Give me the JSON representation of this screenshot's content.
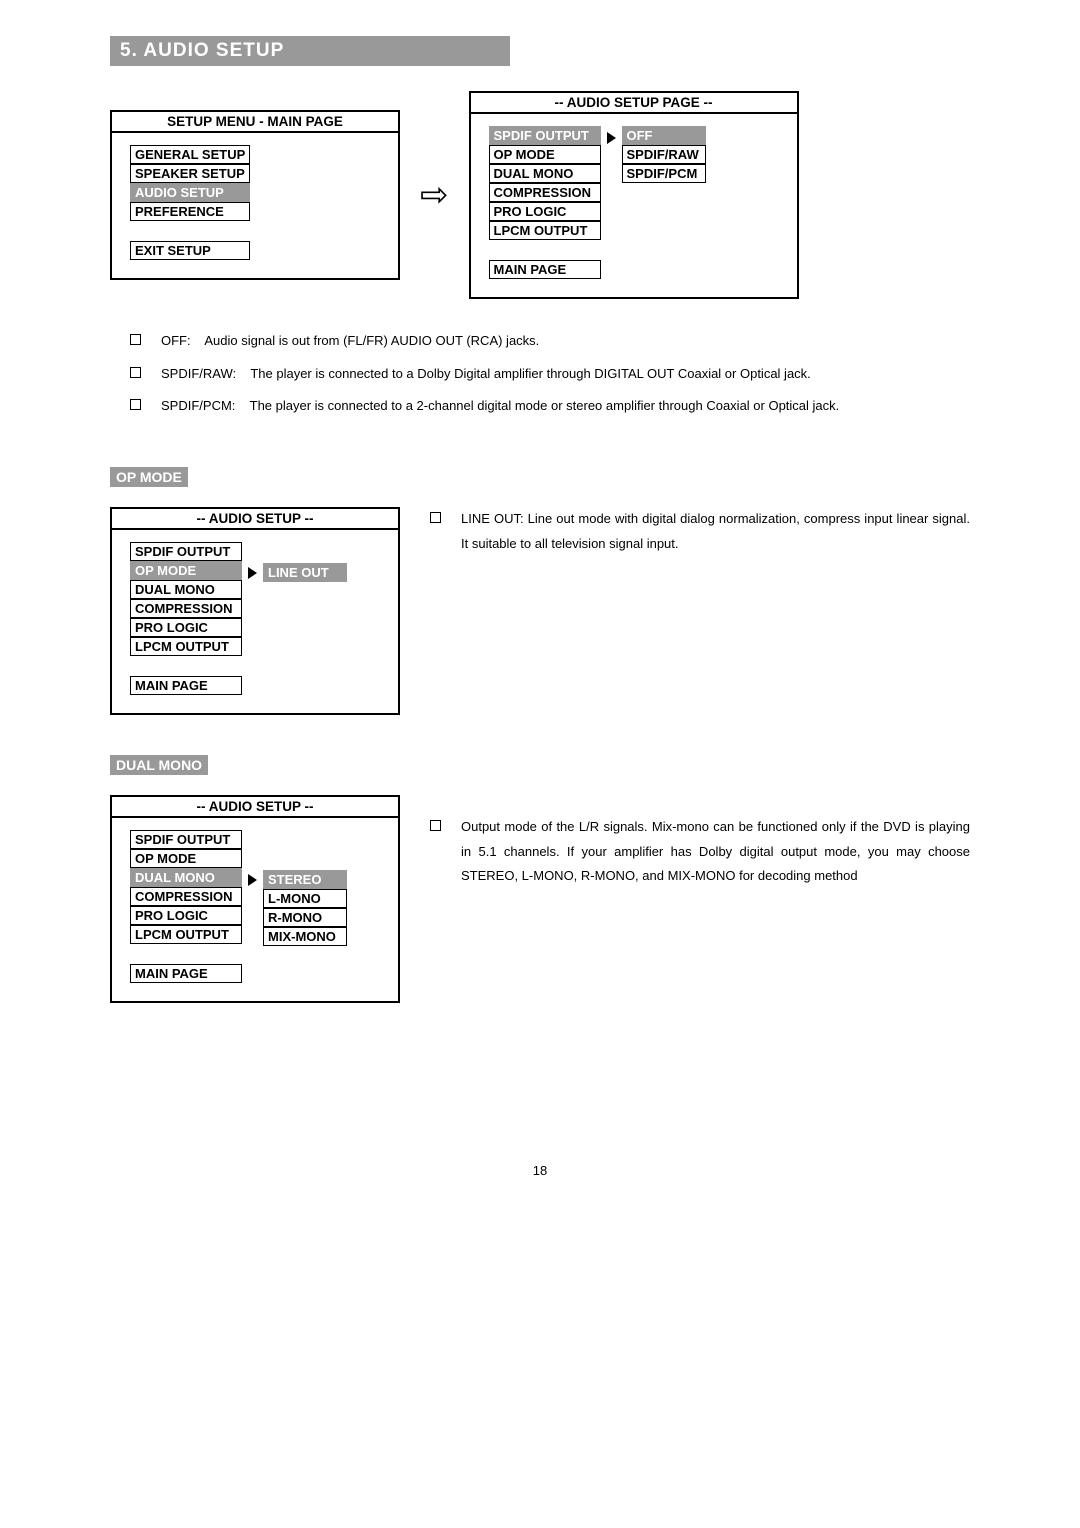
{
  "header": {
    "title": "5.  AUDIO  SETUP"
  },
  "setup_menu": {
    "title": "SETUP MENU    -    MAIN PAGE",
    "items": [
      "GENERAL SETUP",
      "SPEAKER SETUP",
      "AUDIO SETUP",
      "PREFERENCE"
    ],
    "highlight_index": 2,
    "footer": "EXIT SETUP"
  },
  "audio_page": {
    "title": "-- AUDIO SETUP PAGE --",
    "items": [
      "SPDIF OUTPUT",
      "OP MODE",
      "DUAL MONO",
      "COMPRESSION",
      "PRO LOGIC",
      "LPCM OUTPUT"
    ],
    "highlight_index": 0,
    "footer": "MAIN PAGE",
    "values": [
      "OFF",
      "SPDIF/RAW",
      "SPDIF/PCM"
    ],
    "value_highlight_index": 0
  },
  "spdif_bullets": [
    {
      "label": "OFF:",
      "text": "Audio signal is out from (FL/FR) AUDIO OUT (RCA) jacks."
    },
    {
      "label": "SPDIF/RAW:",
      "text": "The player is connected to a Dolby Digital amplifier through DIGITAL OUT Coaxial or Optical jack."
    },
    {
      "label": "SPDIF/PCM:",
      "text": "The player is connected to a 2-channel digital mode or stereo amplifier through Coaxial or Optical jack."
    }
  ],
  "opmode": {
    "heading": "OP MODE",
    "box_title": "-- AUDIO SETUP --",
    "items": [
      "SPDIF OUTPUT",
      "OP MODE",
      "DUAL MONO",
      "COMPRESSION",
      "PRO LOGIC",
      "LPCM OUTPUT"
    ],
    "highlight_index": 1,
    "footer": "MAIN PAGE",
    "values": [
      "LINE OUT"
    ],
    "value_highlight_index": 0,
    "desc": "LINE OUT: Line out mode with digital dialog normalization, compress input linear signal. It suitable to all television signal input."
  },
  "dualmono": {
    "heading": "DUAL MONO",
    "box_title": "-- AUDIO SETUP --",
    "items": [
      "SPDIF OUTPUT",
      "OP MODE",
      "DUAL MONO",
      "COMPRESSION",
      "PRO LOGIC",
      "LPCM OUTPUT"
    ],
    "highlight_index": 2,
    "footer": "MAIN PAGE",
    "values": [
      "STEREO",
      "L-MONO",
      "R-MONO",
      "MIX-MONO"
    ],
    "value_highlight_index": 0,
    "desc": "Output mode of the L/R signals. Mix-mono can be functioned only if the DVD is playing in 5.1 channels. If your amplifier has Dolby digital output mode, you may choose STEREO, L-MONO, R-MONO, and MIX-MONO for decoding method"
  },
  "page_number": "18"
}
